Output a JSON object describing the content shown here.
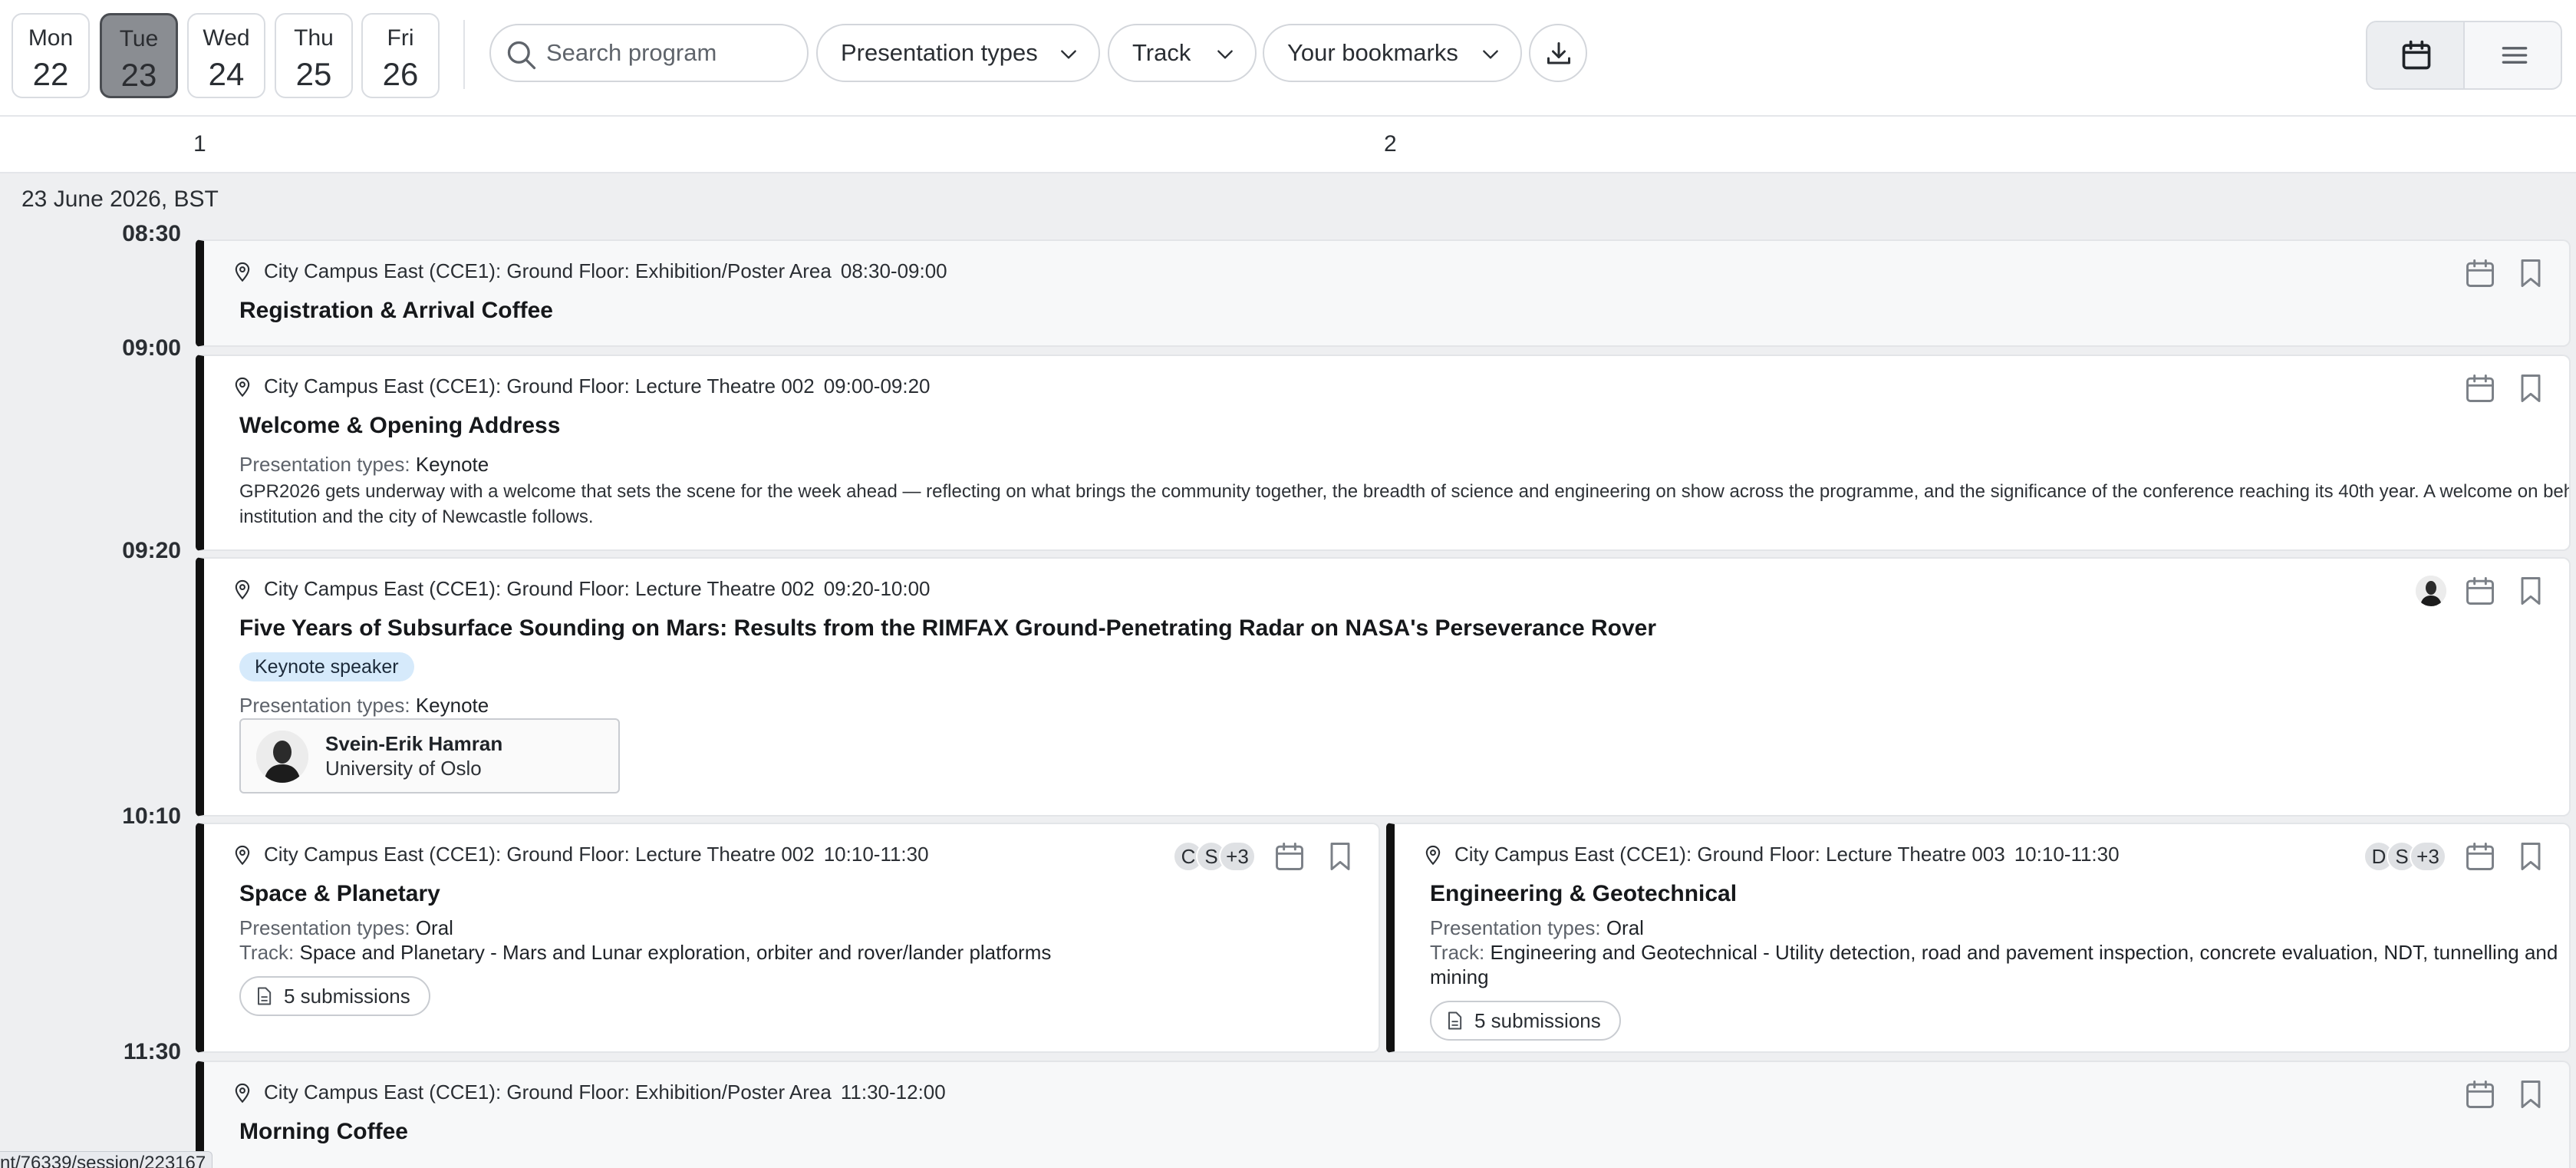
{
  "days": [
    {
      "name": "Mon",
      "num": "22"
    },
    {
      "name": "Tue",
      "num": "23",
      "active": true
    },
    {
      "name": "Wed",
      "num": "24"
    },
    {
      "name": "Thu",
      "num": "25"
    },
    {
      "name": "Fri",
      "num": "26"
    }
  ],
  "toolbar": {
    "search_placeholder": "Search program",
    "filter_presentation_types": "Presentation types",
    "filter_track": "Track",
    "filter_bookmarks": "Your bookmarks",
    "icons": {
      "search": "search-icon",
      "download": "download-icon",
      "calendar_view": "calendar-icon",
      "list_view": "menu-icon"
    }
  },
  "columns": [
    "1",
    "2"
  ],
  "date_label": "23 June 2026, BST",
  "times": [
    "08:30",
    "09:00",
    "09:20",
    "10:10",
    "11:30"
  ],
  "labels": {
    "presentation_types": "Presentation types:",
    "track": "Track:"
  },
  "sessions": {
    "registration": {
      "location": "City Campus East (CCE1): Ground Floor: Exhibition/Poster Area",
      "time": "08:30-09:00",
      "title": "Registration & Arrival Coffee"
    },
    "welcome": {
      "location": "City Campus East (CCE1): Ground Floor: Lecture Theatre 002",
      "time": "09:00-09:20",
      "title": "Welcome & Opening Address",
      "type": "Keynote",
      "description": "GPR2026 gets underway with a welcome that sets the scene for the week ahead — reflecting on what brings the community together, the breadth of science and engineering on show across the programme, and the significance of the conference reaching its 40th year. A welcome on behalf of the host institution and the city of Newcastle follows."
    },
    "keynote": {
      "location": "City Campus East (CCE1): Ground Floor: Lecture Theatre 002",
      "time": "09:20-10:00",
      "title": "Five Years of Subsurface Sounding on Mars: Results from the RIMFAX Ground-Penetrating Radar on NASA's Perseverance Rover",
      "badge": "Keynote speaker",
      "type": "Keynote",
      "speaker": {
        "name": "Svein-Erik Hamran",
        "affiliation": "University of Oslo"
      }
    },
    "space": {
      "location": "City Campus East (CCE1): Ground Floor: Lecture Theatre 002",
      "time": "10:10-11:30",
      "title": "Space & Planetary",
      "type": "Oral",
      "track": "Space and Planetary - Mars and Lunar exploration, orbiter and rover/lander platforms",
      "submissions": "5 submissions",
      "avatars": [
        "C",
        "S",
        "+3"
      ]
    },
    "engineering": {
      "location": "City Campus East (CCE1): Ground Floor: Lecture Theatre 003",
      "time": "10:10-11:30",
      "title": "Engineering & Geotechnical",
      "type": "Oral",
      "track_line1": "Engineering and Geotechnical - Utility detection, road and pavement inspection, concrete evaluation, NDT, tunnelling and",
      "track_line2": "mining",
      "submissions": "5 submissions",
      "avatars": [
        "D",
        "S",
        "+3"
      ]
    },
    "coffee": {
      "location": "City Campus East (CCE1): Ground Floor: Exhibition/Poster Area",
      "time": "11:30-12:00",
      "title": "Morning Coffee"
    }
  },
  "status_url": "nt/76339/session/223167"
}
